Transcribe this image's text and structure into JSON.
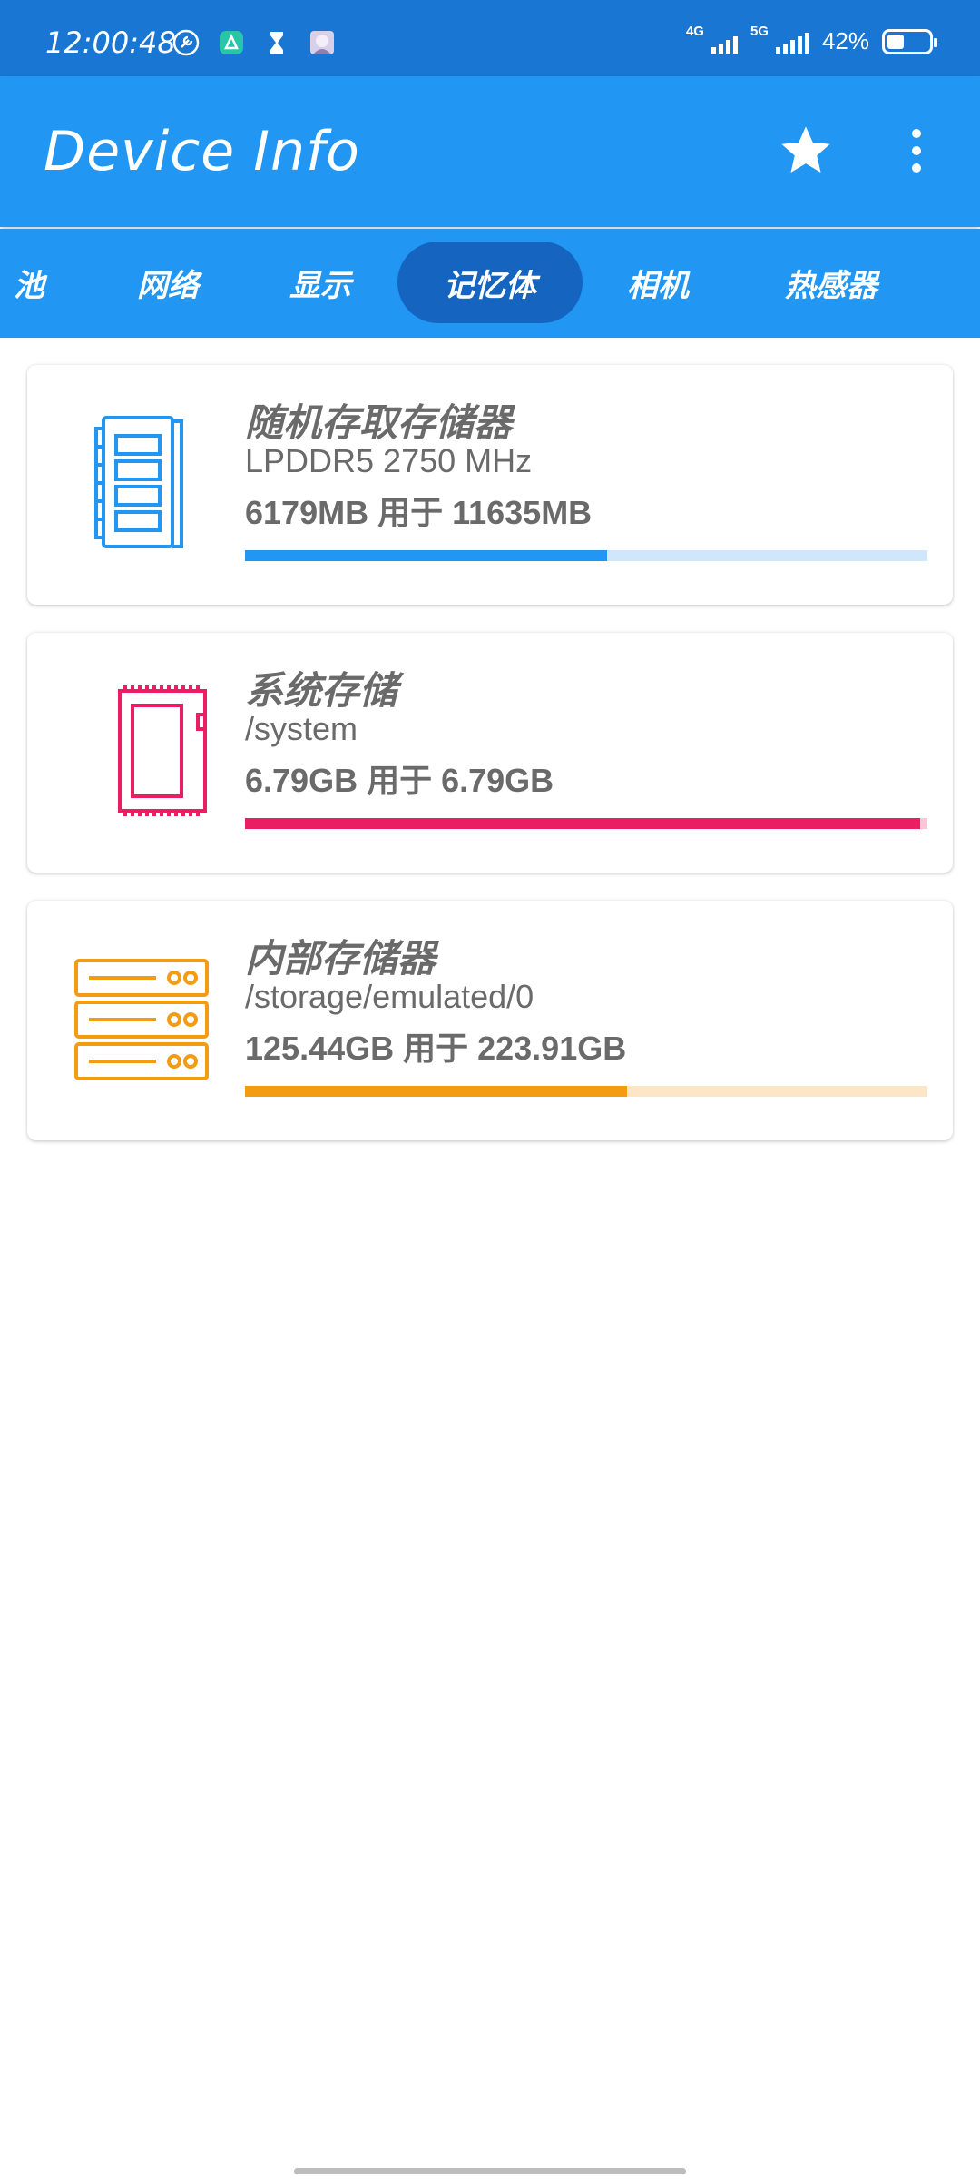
{
  "status_bar": {
    "time": "12:00:48",
    "net1": "4G",
    "net2": "5G",
    "battery": "42%",
    "battery_level": 0.42,
    "icons": [
      "wrench-icon",
      "app-icon",
      "hourglass-icon",
      "avatar-icon"
    ]
  },
  "app_bar": {
    "title": "Device Info",
    "star_icon": "star-icon",
    "more_icon": "more-vert-icon"
  },
  "tabs": [
    {
      "label": "池",
      "active": false
    },
    {
      "label": "网络",
      "active": false
    },
    {
      "label": "显示",
      "active": false
    },
    {
      "label": "记忆体",
      "active": true
    },
    {
      "label": "相机",
      "active": false
    },
    {
      "label": "热感器",
      "active": false
    }
  ],
  "cards": [
    {
      "title": "随机存取存储器",
      "subtitle": "LPDDR5 2750 MHz",
      "usage": "6179MB 用于 11635MB",
      "progress": 0.531,
      "color": "#2196f3",
      "track": "#cfe6fb",
      "icon": "ram-icon"
    },
    {
      "title": "系统存储",
      "subtitle": "/system",
      "usage": "6.79GB 用于 6.79GB",
      "progress": 0.99,
      "color": "#e91e63",
      "track": "#f8c7d8",
      "icon": "chip-icon"
    },
    {
      "title": "内部存储器",
      "subtitle": "/storage/emulated/0",
      "usage": "125.44GB 用于 223.91GB",
      "progress": 0.56,
      "color": "#f39c12",
      "track": "#fde6c6",
      "icon": "storage-icon"
    }
  ]
}
